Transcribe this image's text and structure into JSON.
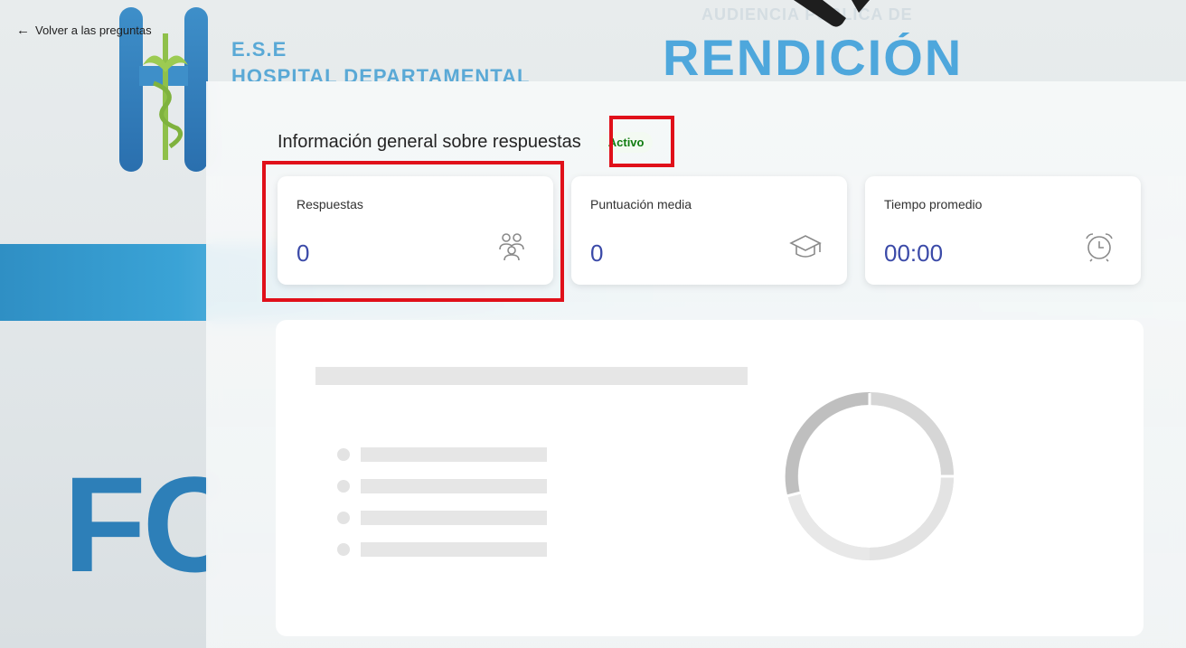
{
  "background": {
    "ese": "E.S.E",
    "hospital": "HOSPITAL DEPARTAMENTAL",
    "audiencia": "AUDIENCIA PÚBLICA DE",
    "rendicion": "RENDICIÓN",
    "fo": "FC"
  },
  "nav": {
    "back_label": "Volver a las preguntas"
  },
  "overview": {
    "title": "Información general sobre respuestas",
    "status": "Activo"
  },
  "stats": [
    {
      "label": "Respuestas",
      "value": "0",
      "icon": "people-icon"
    },
    {
      "label": "Puntuación media",
      "value": "0",
      "icon": "graduation-cap-icon"
    },
    {
      "label": "Tiempo promedio",
      "value": "00:00",
      "icon": "alarm-clock-icon"
    }
  ],
  "colors": {
    "accent": "#3b4aa8",
    "status_green": "#107c10",
    "highlight_red": "#e0101a"
  }
}
